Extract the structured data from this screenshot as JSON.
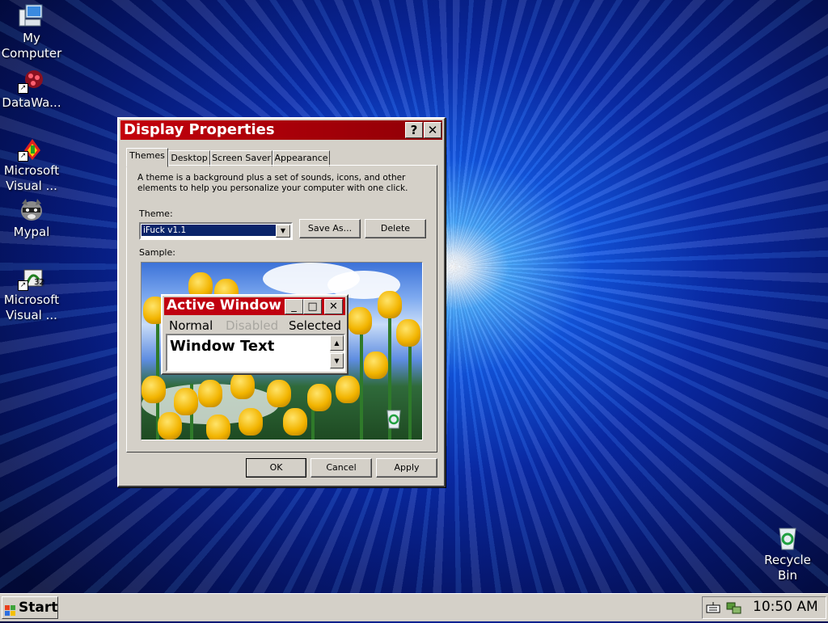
{
  "desktop": {
    "icons": [
      {
        "label": "My Computer",
        "icon": "computer-icon"
      },
      {
        "label": "DataWa...",
        "icon": "datawarehouse-icon"
      },
      {
        "label": "Microsoft Visual ...",
        "icon": "visual-studio-icon"
      },
      {
        "label": "Mypal",
        "icon": "raccoon-icon"
      },
      {
        "label": "Microsoft Visual ...",
        "icon": "visual-foxpro-icon"
      },
      {
        "label": "Recycle Bin",
        "icon": "recycle-bin-icon"
      }
    ]
  },
  "dialog": {
    "title": "Display Properties",
    "help_button": "?",
    "close_button": "✕",
    "tabs": [
      "Themes",
      "Desktop",
      "Screen Saver",
      "Appearance"
    ],
    "active_tab": "Themes",
    "description": "A theme is a background plus a set of sounds, icons, and other elements to help you personalize your computer with one click.",
    "theme_label": "Theme:",
    "theme_value": "iFuck v1.1",
    "save_as_button": "Save As...",
    "delete_button": "Delete",
    "sample_label": "Sample:",
    "sample": {
      "window_title": "Active Window",
      "menu_normal": "Normal",
      "menu_disabled": "Disabled",
      "menu_selected": "Selected",
      "window_text": "Window Text"
    },
    "ok_button": "OK",
    "cancel_button": "Cancel",
    "apply_button": "Apply"
  },
  "taskbar": {
    "start_label": "Start",
    "clock": "10:50 AM"
  },
  "colors": {
    "title_red": "#c4000c",
    "selection_navy": "#0a246a",
    "window_gray": "#d4d0c8"
  }
}
